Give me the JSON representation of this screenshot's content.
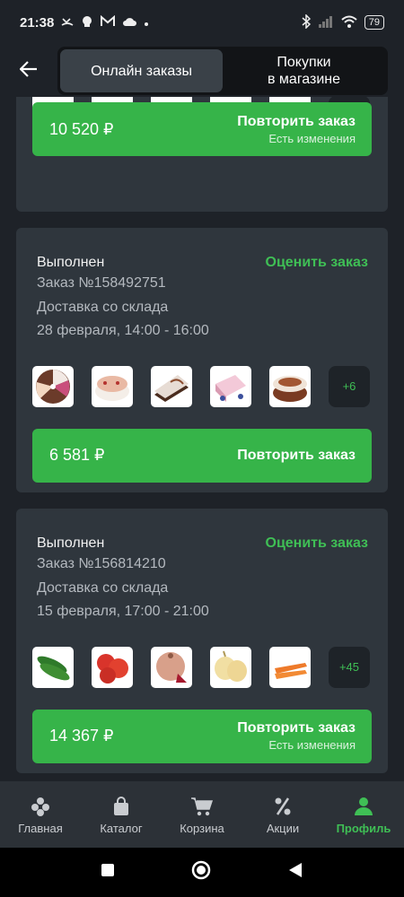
{
  "status_bar": {
    "time": "21:38",
    "battery": "79"
  },
  "header": {
    "tabs": [
      {
        "label": "Онлайн заказы"
      },
      {
        "label": "Покупки\nв магазине"
      }
    ]
  },
  "orders": [
    {
      "price": "10 520 ₽",
      "repeat_label": "Повторить заказ",
      "changes_note": "Есть изменения"
    },
    {
      "status": "Выполнен",
      "rate_label": "Оценить заказ",
      "order_number": "Заказ №158492751",
      "delivery_type": "Доставка со склада",
      "delivery_time": "28 февраля, 14:00 - 16:00",
      "more_count": "+6",
      "price": "6 581 ₽",
      "repeat_label": "Повторить заказ"
    },
    {
      "status": "Выполнен",
      "rate_label": "Оценить заказ",
      "order_number": "Заказ №156814210",
      "delivery_type": "Доставка со склада",
      "delivery_time": "15 февраля, 17:00 - 21:00",
      "more_count": "+45",
      "price": "14 367 ₽",
      "repeat_label": "Повторить заказ",
      "changes_note": "Есть изменения"
    }
  ],
  "bottom_nav": [
    {
      "label": "Главная",
      "icon": "home-icon"
    },
    {
      "label": "Каталог",
      "icon": "bag-icon"
    },
    {
      "label": "Корзина",
      "icon": "cart-icon"
    },
    {
      "label": "Акции",
      "icon": "percent-icon"
    },
    {
      "label": "Профиль",
      "icon": "profile-icon"
    }
  ],
  "colors": {
    "accent": "#36b449",
    "background": "#1e2228",
    "card": "#2f363d"
  }
}
